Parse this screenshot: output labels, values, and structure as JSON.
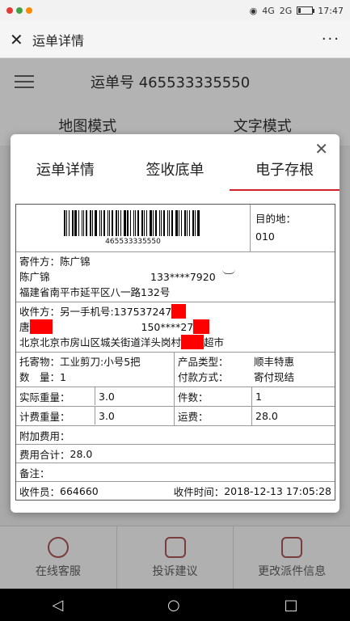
{
  "status_bar": {
    "network": "4G",
    "network2": "2G",
    "time": "17:47"
  },
  "titlebar": {
    "title": "运单详情",
    "close_glyph": "✕",
    "more_glyph": "···"
  },
  "background_page": {
    "header_title": "运单号 465533335550",
    "tabs": [
      "地图模式",
      "文字模式"
    ],
    "bottom": [
      {
        "label": "在线客服",
        "icon": "headset-icon"
      },
      {
        "label": "投诉建议",
        "icon": "edit-icon"
      },
      {
        "label": "更改派件信息",
        "icon": "box-icon"
      }
    ]
  },
  "modal": {
    "close_glyph": "✕",
    "tabs": [
      {
        "label": "运单详情",
        "active": false
      },
      {
        "label": "签收底单",
        "active": false
      },
      {
        "label": "电子存根",
        "active": true
      }
    ],
    "accent": "#d0202a"
  },
  "waybill": {
    "barcode_number": "465533335550",
    "destination_label": "目的地：",
    "destination_code": "010",
    "sender_label": "寄件方：",
    "sender_name": "陈广锦",
    "sender_contact": "陈广锦",
    "sender_phone": "133****7920",
    "sender_address": "福建省南平市延平区八一路132号",
    "receiver_label": "收件方：",
    "receiver_extra": "另一手机号:137537247",
    "receiver_name": "唐",
    "receiver_phone": "150****27",
    "receiver_address_a": "北京北京市房山区城关街道洋头岗村",
    "receiver_address_b": "超市",
    "goods_label": "托寄物：",
    "goods_value": "工业剪刀:小号5把",
    "qty_label": "数　量：",
    "qty_value": "1",
    "product_label": "产品类型：",
    "product_value": "顺丰特惠",
    "pay_label": "付款方式：",
    "pay_value": "寄付现结",
    "actual_weight_label": "实际重量：",
    "actual_weight_value": "3.0",
    "pieces_label": "件数：",
    "pieces_value": "1",
    "charge_weight_label": "计费重量：",
    "charge_weight_value": "3.0",
    "freight_label": "运费：",
    "freight_value": "28.0",
    "extra_fee_label": "附加费用：",
    "total_label": "费用合计：",
    "total_value": "28.0",
    "remark_label": "备注：",
    "courier_label": "收件员：",
    "courier_value": "664660",
    "time_label": "收件时间：",
    "time_value": "2018-12-13 17:05:28"
  }
}
